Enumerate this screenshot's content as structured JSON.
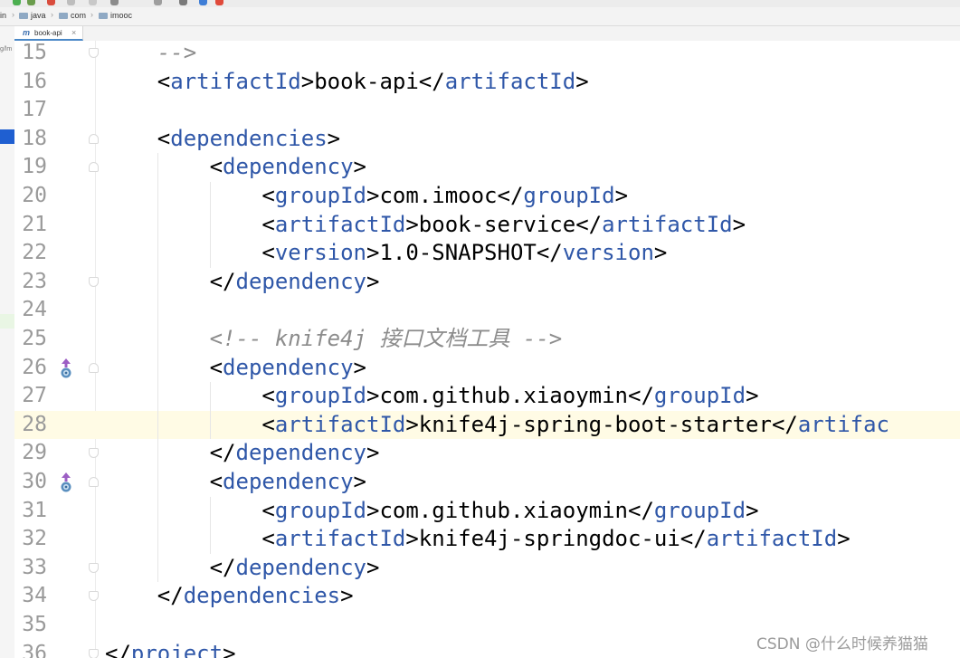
{
  "breadcrumb": {
    "items": [
      "in",
      "java",
      "com",
      "imooc"
    ]
  },
  "tab": {
    "icon": "m-maven-icon",
    "label": "book-api",
    "close": "×"
  },
  "side_panel": {
    "text": "g/lm"
  },
  "editor": {
    "current_line": 28,
    "lines": [
      {
        "n": "15",
        "text": "    -->"
      },
      {
        "n": "16",
        "text": "    <artifactId>book-api</artifactId>"
      },
      {
        "n": "17",
        "text": ""
      },
      {
        "n": "18",
        "text": "    <dependencies>"
      },
      {
        "n": "19",
        "text": "        <dependency>"
      },
      {
        "n": "20",
        "text": "            <groupId>com.imooc</groupId>"
      },
      {
        "n": "21",
        "text": "            <artifactId>book-service</artifactId>"
      },
      {
        "n": "22",
        "text": "            <version>1.0-SNAPSHOT</version>"
      },
      {
        "n": "23",
        "text": "        </dependency>"
      },
      {
        "n": "24",
        "text": ""
      },
      {
        "n": "25",
        "text": "        <!-- knife4j 接口文档工具 -->"
      },
      {
        "n": "26",
        "text": "        <dependency>"
      },
      {
        "n": "27",
        "text": "            <groupId>com.github.xiaoymin</groupId>"
      },
      {
        "n": "28",
        "text": "            <artifactId>knife4j-spring-boot-starter</artifac"
      },
      {
        "n": "29",
        "text": "        </dependency>"
      },
      {
        "n": "30",
        "text": "        <dependency>"
      },
      {
        "n": "31",
        "text": "            <groupId>com.github.xiaoymin</groupId>"
      },
      {
        "n": "32",
        "text": "            <artifactId>knife4j-springdoc-ui</artifactId>"
      },
      {
        "n": "33",
        "text": "        </dependency>"
      },
      {
        "n": "34",
        "text": "    </dependencies>"
      },
      {
        "n": "35",
        "text": ""
      },
      {
        "n": "36",
        "text": "</project>"
      }
    ]
  },
  "watermark": "CSDN @什么时候养猫猫",
  "colors": {
    "tag": "#2f57a8",
    "comment": "#8c8c8c",
    "current_line": "#fffbe5",
    "selection_marker": "#1f5fd1"
  }
}
